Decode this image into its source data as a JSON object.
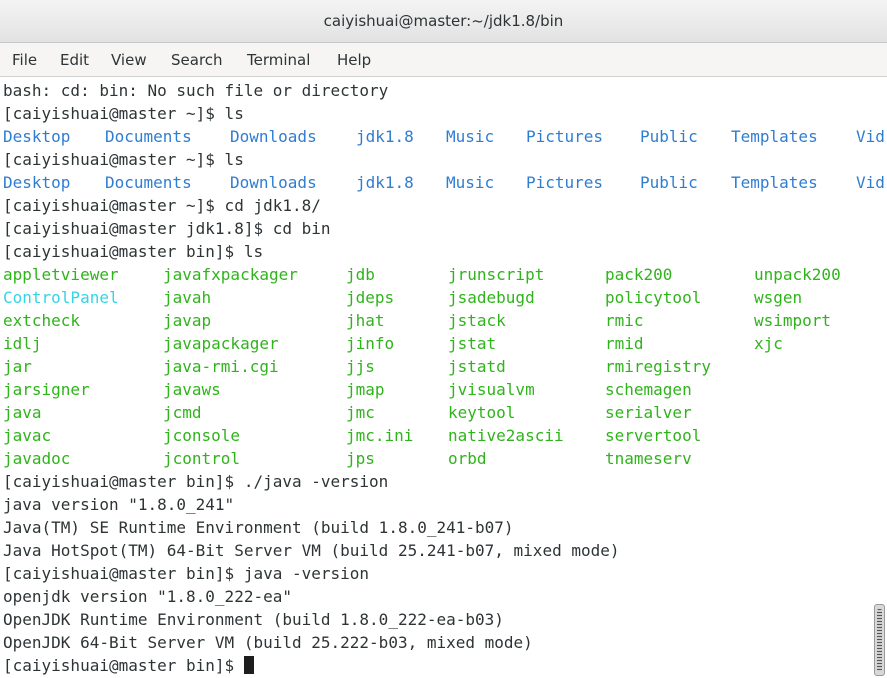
{
  "window": {
    "title": "caiyishuai@master:~/jdk1.8/bin"
  },
  "menu": [
    "File",
    "Edit",
    "View",
    "Search",
    "Terminal",
    "Help"
  ],
  "colors": {
    "text": "#2e3436",
    "dir_blue": "#2f7dd1",
    "exec_green": "#2fb41b",
    "link_cyan": "#35d4e6"
  },
  "terminal": {
    "lines": [
      {
        "text": "bash: cd: bin: No such file or directory"
      },
      {
        "text": "[caiyishuai@master ~]$ ls"
      },
      {
        "ls_dirs": [
          "Desktop",
          "Documents",
          "Downloads",
          "jdk1.8",
          "Music",
          "Pictures",
          "Public",
          "Templates",
          "Vid"
        ]
      },
      {
        "text": "[caiyishuai@master ~]$ ls"
      },
      {
        "ls_dirs": [
          "Desktop",
          "Documents",
          "Downloads",
          "jdk1.8",
          "Music",
          "Pictures",
          "Public",
          "Templates",
          "Vid"
        ]
      },
      {
        "text": "[caiyishuai@master ~]$ cd jdk1.8/"
      },
      {
        "text": "[caiyishuai@master jdk1.8]$ cd bin"
      },
      {
        "text": "[caiyishuai@master bin]$ ls"
      },
      {
        "ls_bin": [
          "appletviewer",
          "javafxpackager",
          "jdb",
          "jrunscript",
          "pack200",
          "unpack200"
        ]
      },
      {
        "ls_bin": [
          "ControlPanel",
          "javah",
          "jdeps",
          "jsadebugd",
          "policytool",
          "wsgen"
        ]
      },
      {
        "ls_bin": [
          "extcheck",
          "javap",
          "jhat",
          "jstack",
          "rmic",
          "wsimport"
        ]
      },
      {
        "ls_bin": [
          "idlj",
          "javapackager",
          "jinfo",
          "jstat",
          "rmid",
          "xjc"
        ]
      },
      {
        "ls_bin": [
          "jar",
          "java-rmi.cgi",
          "jjs",
          "jstatd",
          "rmiregistry",
          ""
        ]
      },
      {
        "ls_bin": [
          "jarsigner",
          "javaws",
          "jmap",
          "jvisualvm",
          "schemagen",
          ""
        ]
      },
      {
        "ls_bin": [
          "java",
          "jcmd",
          "jmc",
          "keytool",
          "serialver",
          ""
        ]
      },
      {
        "ls_bin": [
          "javac",
          "jconsole",
          "jmc.ini",
          "native2ascii",
          "servertool",
          ""
        ]
      },
      {
        "ls_bin": [
          "javadoc",
          "jcontrol",
          "jps",
          "orbd",
          "tnameserv",
          ""
        ]
      },
      {
        "text": "[caiyishuai@master bin]$ ./java -version"
      },
      {
        "text": "java version \"1.8.0_241\""
      },
      {
        "text": "Java(TM) SE Runtime Environment (build 1.8.0_241-b07)"
      },
      {
        "text": "Java HotSpot(TM) 64-Bit Server VM (build 25.241-b07, mixed mode)"
      },
      {
        "text": "[caiyishuai@master bin]$ java -version"
      },
      {
        "text": "openjdk version \"1.8.0_222-ea\""
      },
      {
        "text": "OpenJDK Runtime Environment (build 1.8.0_222-ea-b03)"
      },
      {
        "text": "OpenJDK 64-Bit Server VM (build 25.222-b03, mixed mode)"
      },
      {
        "text": "[caiyishuai@master bin]$ ",
        "cursor": true
      }
    ]
  }
}
